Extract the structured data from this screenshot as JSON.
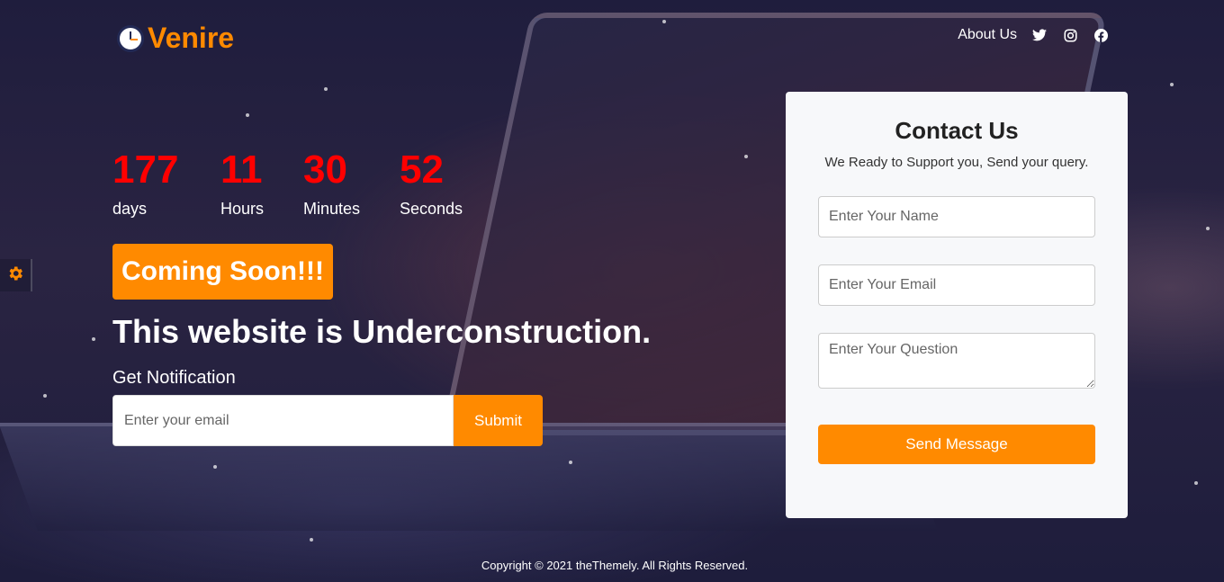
{
  "brand": {
    "name": "Venire",
    "accent_color": "#ff8a00",
    "icon": "clock-icon"
  },
  "nav": {
    "about_label": "About Us",
    "social": [
      "twitter-icon",
      "instagram-icon",
      "facebook-icon"
    ]
  },
  "countdown": {
    "days": {
      "value": "177",
      "label": "days"
    },
    "hours": {
      "value": "11",
      "label": "Hours"
    },
    "minutes": {
      "value": "30",
      "label": "Minutes"
    },
    "seconds": {
      "value": "52",
      "label": "Seconds"
    },
    "number_color": "#ff0000"
  },
  "hero": {
    "badge": "Coming Soon!!!",
    "headline": "This website is Underconstruction."
  },
  "notification": {
    "label": "Get Notification",
    "placeholder": "Enter your email",
    "button": "Submit"
  },
  "contact": {
    "title": "Contact Us",
    "subtitle": "We Ready to Support you, Send your query.",
    "name_placeholder": "Enter Your Name",
    "email_placeholder": "Enter Your Email",
    "question_placeholder": "Enter Your Question",
    "button": "Send Message"
  },
  "settings_icon": "gear-icon",
  "footer": {
    "copyright": "Copyright © 2021 theThemely. All Rights Reserved."
  }
}
